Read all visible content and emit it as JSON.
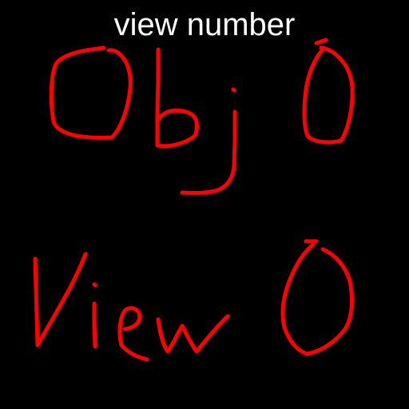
{
  "title": "view number",
  "handwriting": {
    "line1": "Obj 0",
    "line2": "View 0",
    "ink_color": "#ff0000"
  },
  "colors": {
    "background": "#000000",
    "title_text": "#ffffff",
    "ink": "#ff0000"
  }
}
